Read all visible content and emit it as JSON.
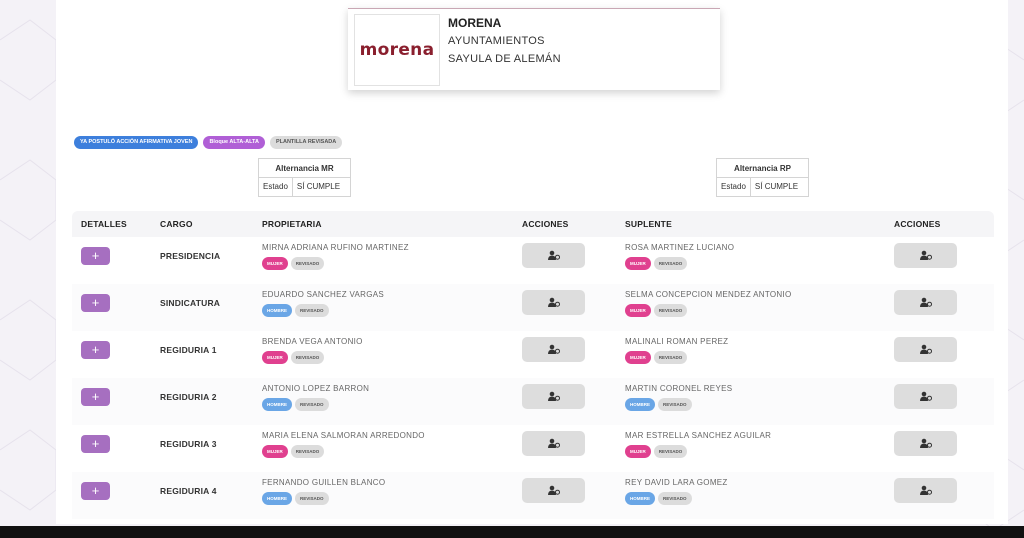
{
  "party": {
    "logo_text": "morena",
    "name": "MORENA",
    "line1": "AYUNTAMIENTOS",
    "line2": "SAYULA DE ALEMÁN"
  },
  "status_pills": [
    {
      "label": "YA POSTULÓ ACCIÓN AFIRMATIVA JOVEN",
      "color": "#3d7fdc"
    },
    {
      "label": "Bloque ALTA-ALTA",
      "color": "#b05fd6"
    },
    {
      "label": "PLANTILLA REVISADA",
      "color": "#dcdcdc"
    }
  ],
  "alternancia_mr": {
    "title": "Alternancia MR",
    "estado_label": "Estado",
    "estado_value": "SÍ CUMPLE"
  },
  "alternancia_rp": {
    "title": "Alternancia RP",
    "estado_label": "Estado",
    "estado_value": "SÍ CUMPLE"
  },
  "table": {
    "headers": {
      "detalles": "DETALLES",
      "cargo": "CARGO",
      "propietaria": "PROPIETARIA",
      "acciones1": "ACCIONES",
      "suplente": "SUPLENTE",
      "acciones2": "ACCIONES"
    },
    "details_button_label": "+",
    "rows": [
      {
        "cargo": "PRESIDENCIA",
        "propietaria": {
          "name": "MIRNA ADRIANA RUFINO MARTINEZ",
          "gender": "MUJER",
          "status": "REVISADO"
        },
        "suplente": {
          "name": "ROSA MARTINEZ LUCIANO",
          "gender": "MUJER",
          "status": "REVISADO"
        }
      },
      {
        "cargo": "SINDICATURA",
        "propietaria": {
          "name": "EDUARDO SANCHEZ VARGAS",
          "gender": "HOMBRE",
          "status": "REVISADO"
        },
        "suplente": {
          "name": "SELMA CONCEPCION MENDEZ ANTONIO",
          "gender": "MUJER",
          "status": "REVISADO"
        }
      },
      {
        "cargo": "REGIDURIA 1",
        "propietaria": {
          "name": "BRENDA VEGA ANTONIO",
          "gender": "MUJER",
          "status": "REVISADO"
        },
        "suplente": {
          "name": "MALINALI ROMAN PEREZ",
          "gender": "MUJER",
          "status": "REVISADO"
        }
      },
      {
        "cargo": "REGIDURIA 2",
        "propietaria": {
          "name": "ANTONIO LOPEZ BARRON",
          "gender": "HOMBRE",
          "status": "REVISADO"
        },
        "suplente": {
          "name": "MARTIN CORONEL REYES",
          "gender": "HOMBRE",
          "status": "REVISADO"
        }
      },
      {
        "cargo": "REGIDURIA 3",
        "propietaria": {
          "name": "MARIA ELENA SALMORAN ARREDONDO",
          "gender": "MUJER",
          "status": "REVISADO"
        },
        "suplente": {
          "name": "MAR ESTRELLA SANCHEZ AGUILAR",
          "gender": "MUJER",
          "status": "REVISADO"
        }
      },
      {
        "cargo": "REGIDURIA 4",
        "propietaria": {
          "name": "FERNANDO GUILLEN BLANCO",
          "gender": "HOMBRE",
          "status": "REVISADO"
        },
        "suplente": {
          "name": "REY DAVID LARA GOMEZ",
          "gender": "HOMBRE",
          "status": "REVISADO"
        }
      }
    ]
  },
  "colors": {
    "accent_purple": "#a66fc0",
    "mujer": "#e0408f",
    "hombre": "#6aa6e6",
    "logo": "#8a1f2e"
  },
  "icons": {
    "action": "user-plus-icon"
  }
}
